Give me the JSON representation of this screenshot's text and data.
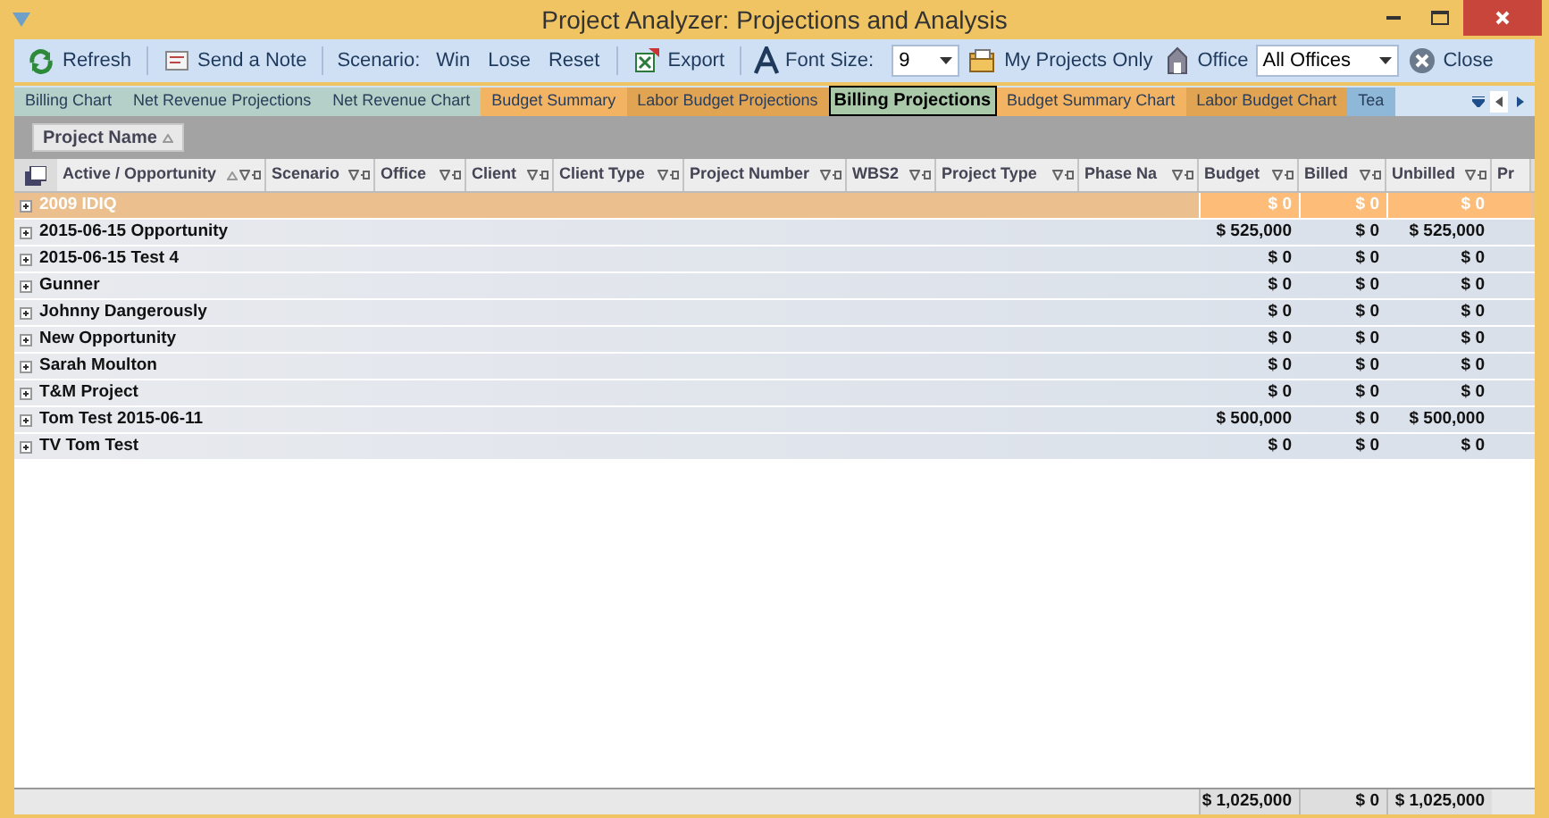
{
  "window": {
    "title": "Project Analyzer: Projections and Analysis"
  },
  "toolbar": {
    "refresh": "Refresh",
    "send_note": "Send a Note",
    "scenario": {
      "label": "Scenario:",
      "buttons": [
        "Win",
        "Lose",
        "Reset"
      ]
    },
    "export": "Export",
    "font_size": {
      "label": "Font Size:",
      "value": "9"
    },
    "my_projects": "My Projects Only",
    "office": {
      "label": "Office",
      "value": "All Offices"
    },
    "close": "Close"
  },
  "tabs": [
    {
      "label": "Billing Chart",
      "selected": false,
      "color": "#b4d0c8"
    },
    {
      "label": "Net Revenue Projections",
      "selected": false,
      "color": "#b4d0c8"
    },
    {
      "label": "Net Revenue Chart",
      "selected": false,
      "color": "#b4d0c8"
    },
    {
      "label": "Budget Summary",
      "selected": false,
      "color": "#f2b462"
    },
    {
      "label": "Labor Budget Projections",
      "selected": false,
      "color": "#e0a452"
    },
    {
      "label": "Billing Projections",
      "selected": true,
      "color": "#a9c9a9"
    },
    {
      "label": "Budget Summary Chart",
      "selected": false,
      "color": "#f2b462"
    },
    {
      "label": "Labor Budget Chart",
      "selected": false,
      "color": "#e0a452"
    },
    {
      "label": "Tea",
      "selected": false,
      "color": "#8fb8d8"
    }
  ],
  "group_panel": {
    "label": "Project Name",
    "sorted": true
  },
  "table": {
    "columns": [
      {
        "label": "Active / Opportunity",
        "sorted": true
      },
      {
        "label": "Scenario",
        "sorted": false
      },
      {
        "label": "Office",
        "sorted": false
      },
      {
        "label": "Client",
        "sorted": false
      },
      {
        "label": "Client Type",
        "sorted": false
      },
      {
        "label": "Project Number",
        "sorted": false
      },
      {
        "label": "WBS2",
        "sorted": false
      },
      {
        "label": "Project Type",
        "sorted": false
      },
      {
        "label": "Phase Na",
        "sorted": false
      },
      {
        "label": "Budget",
        "sorted": false
      },
      {
        "label": "Billed",
        "sorted": false
      },
      {
        "label": "Unbilled",
        "sorted": false
      },
      {
        "label": "Pr",
        "sorted": false
      }
    ],
    "rows": [
      {
        "name": "2009 IDIQ",
        "budget": "$ 0",
        "billed": "$ 0",
        "unbilled": "$ 0",
        "selected": true
      },
      {
        "name": "2015-06-15 Opportunity",
        "budget": "$ 525,000",
        "billed": "$ 0",
        "unbilled": "$ 525,000",
        "selected": false
      },
      {
        "name": "2015-06-15 Test 4",
        "budget": "$ 0",
        "billed": "$ 0",
        "unbilled": "$ 0",
        "selected": false
      },
      {
        "name": "Gunner",
        "budget": "$ 0",
        "billed": "$ 0",
        "unbilled": "$ 0",
        "selected": false
      },
      {
        "name": "Johnny Dangerously",
        "budget": "$ 0",
        "billed": "$ 0",
        "unbilled": "$ 0",
        "selected": false
      },
      {
        "name": "New Opportunity",
        "budget": "$ 0",
        "billed": "$ 0",
        "unbilled": "$ 0",
        "selected": false
      },
      {
        "name": "Sarah Moulton",
        "budget": "$ 0",
        "billed": "$ 0",
        "unbilled": "$ 0",
        "selected": false
      },
      {
        "name": "T&M Project",
        "budget": "$ 0",
        "billed": "$ 0",
        "unbilled": "$ 0",
        "selected": false
      },
      {
        "name": "Tom Test 2015-06-11",
        "budget": "$ 500,000",
        "billed": "$ 0",
        "unbilled": "$ 500,000",
        "selected": false
      },
      {
        "name": "TV Tom Test",
        "budget": "$ 0",
        "billed": "$ 0",
        "unbilled": "$ 0",
        "selected": false
      }
    ],
    "totals": {
      "budget": "$ 1,025,000",
      "billed": "$ 0",
      "unbilled": "$ 1,025,000"
    }
  }
}
